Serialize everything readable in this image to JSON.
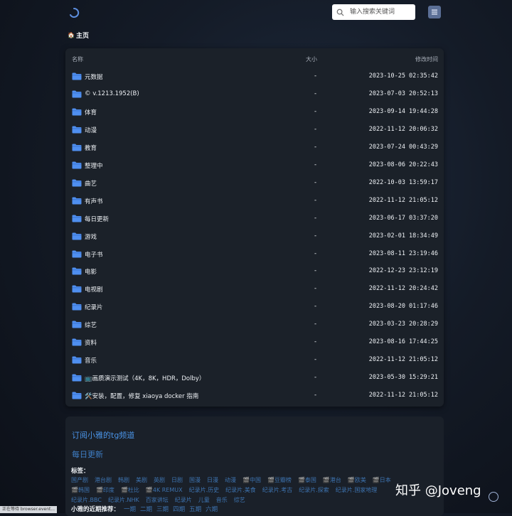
{
  "header": {
    "search_placeholder": "输入搜索关键词"
  },
  "breadcrumb": {
    "icon": "🏠",
    "label": "主页"
  },
  "table": {
    "columns": {
      "name": "名称",
      "size": "大小",
      "modified": "修改时间"
    },
    "rows": [
      {
        "name": "元数据",
        "size": "-",
        "modified": "2023-10-25 02:35:42"
      },
      {
        "name": "© v.1213.1952(B)",
        "size": "-",
        "modified": "2023-07-03 20:52:13"
      },
      {
        "name": "体育",
        "size": "-",
        "modified": "2023-09-14 19:44:28"
      },
      {
        "name": "动漫",
        "size": "-",
        "modified": "2022-11-12 20:06:32"
      },
      {
        "name": "教育",
        "size": "-",
        "modified": "2023-07-24 00:43:29"
      },
      {
        "name": "整理中",
        "size": "-",
        "modified": "2023-08-06 20:22:43"
      },
      {
        "name": "曲艺",
        "size": "-",
        "modified": "2022-10-03 13:59:17"
      },
      {
        "name": "有声书",
        "size": "-",
        "modified": "2022-11-12 21:05:12"
      },
      {
        "name": "每日更新",
        "size": "-",
        "modified": "2023-06-17 03:37:20"
      },
      {
        "name": "游戏",
        "size": "-",
        "modified": "2023-02-01 18:34:49"
      },
      {
        "name": "电子书",
        "size": "-",
        "modified": "2023-08-11 23:19:46"
      },
      {
        "name": "电影",
        "size": "-",
        "modified": "2022-12-23 23:12:19"
      },
      {
        "name": "电视剧",
        "size": "-",
        "modified": "2022-11-12 20:24:42"
      },
      {
        "name": "纪录片",
        "size": "-",
        "modified": "2023-08-20 01:17:46"
      },
      {
        "name": "综艺",
        "size": "-",
        "modified": "2023-03-23 20:28:29"
      },
      {
        "name": "资料",
        "size": "-",
        "modified": "2023-08-16 17:44:25"
      },
      {
        "name": "音乐",
        "size": "-",
        "modified": "2022-11-12 21:05:12"
      },
      {
        "name": "📺画质演示测试（4K，8K，HDR，Dolby）",
        "size": "-",
        "modified": "2023-05-30 15:29:21"
      },
      {
        "name": "🛠️安装，配置，修复 xiaoya docker 指南",
        "size": "-",
        "modified": "2022-11-12 21:05:12"
      }
    ]
  },
  "readme": {
    "tg_title": "订阅小雅的tg频道",
    "daily_title": "每日更新",
    "tags_label": "标签：",
    "tags": [
      "国产剧",
      "港台剧",
      "韩剧",
      "美剧",
      "英剧",
      "日剧",
      "国漫",
      "日漫",
      "动漫",
      "🎬中国",
      "🎬豆瓣榜",
      "🎬泰国",
      "🎬港台",
      "🎬欧美",
      "🎬日本",
      "🎬韩国",
      "🎬印度",
      "🎬杜比",
      "🎬4K REMUX",
      "纪录片.历史",
      "纪录片.美食",
      "纪录片.考古",
      "纪录片.探索",
      "纪录片.国家地理",
      "纪录片.BBC",
      "纪录片.NHK",
      "百家讲坛",
      "纪录片",
      "儿童",
      "音乐",
      "综艺"
    ],
    "recent_label": "小雅的近期推荐：",
    "weekdays": [
      "一期",
      "二期",
      "三期",
      "四期",
      "五期",
      "六期"
    ]
  },
  "watermark": "知乎 @Joveng",
  "status_text": "正在等待 browser.event...",
  "colors": {
    "accent": "#4a93e6",
    "folder": "#4f8ff0",
    "card": "#1b2129"
  }
}
